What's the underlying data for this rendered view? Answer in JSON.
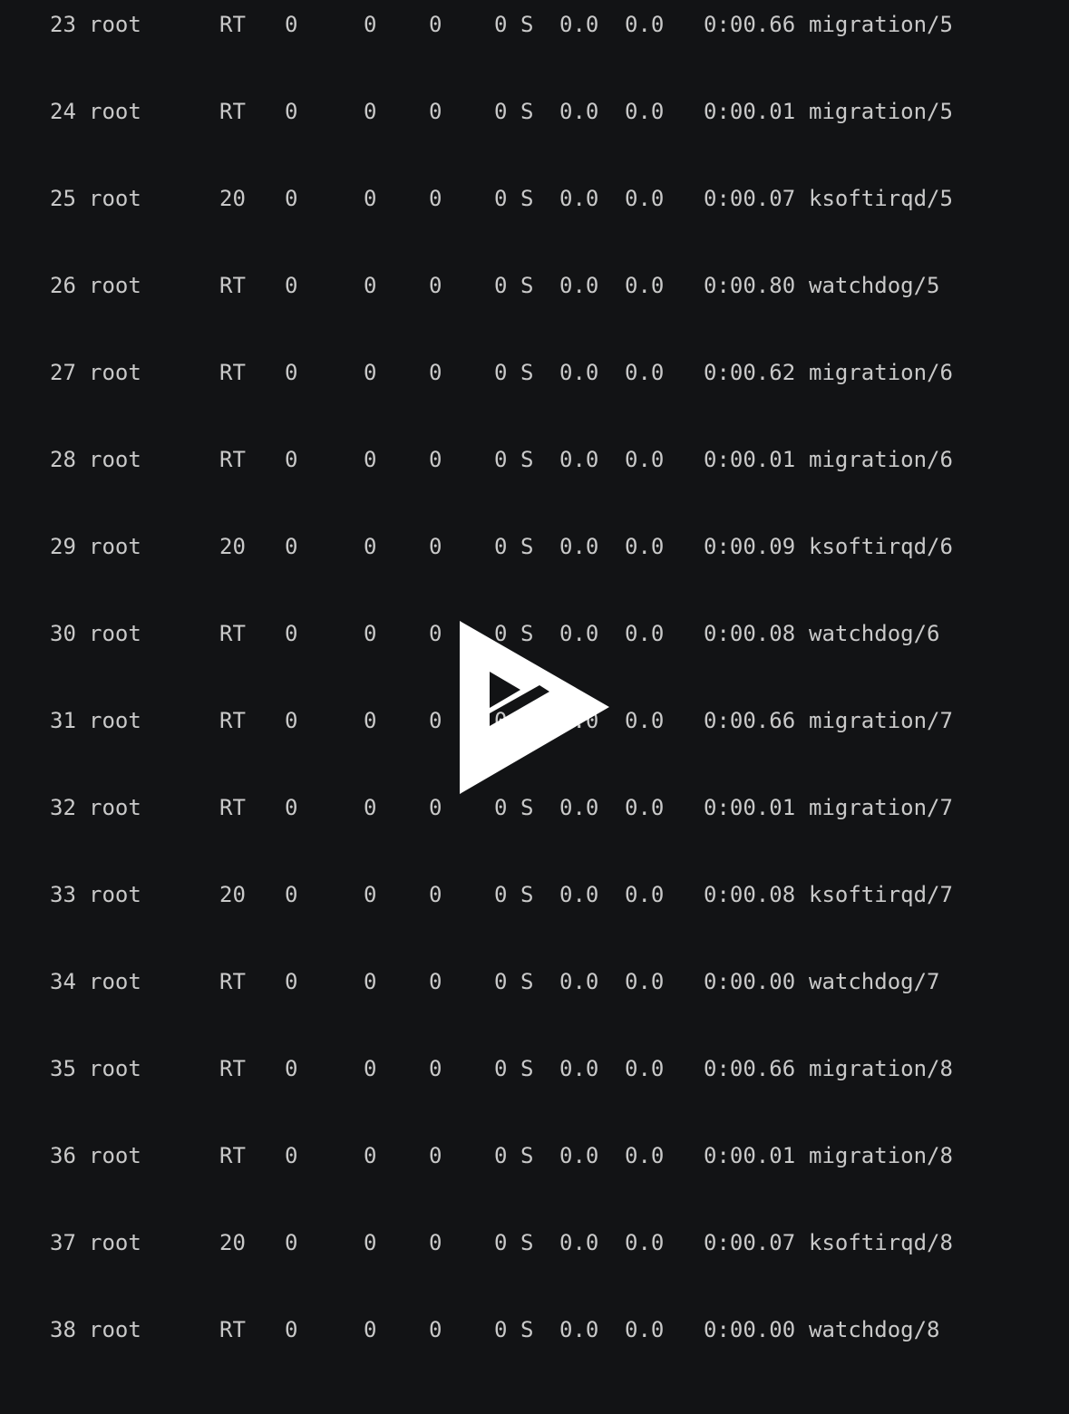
{
  "colors": {
    "background": "#121315",
    "text": "#c9c9c9",
    "overlay_icon": "#ffffff"
  },
  "overlay": {
    "icon": "play-logo-icon"
  },
  "processes": [
    {
      "pid": "23",
      "user": "root",
      "pr": "RT",
      "ni": "0",
      "virt": "0",
      "res": "0",
      "shr": "0",
      "state": "S",
      "cpu": "0.0",
      "mem": "0.0",
      "time": "0:00.66",
      "command": "migration/5"
    },
    {
      "pid": "24",
      "user": "root",
      "pr": "RT",
      "ni": "0",
      "virt": "0",
      "res": "0",
      "shr": "0",
      "state": "S",
      "cpu": "0.0",
      "mem": "0.0",
      "time": "0:00.01",
      "command": "migration/5"
    },
    {
      "pid": "25",
      "user": "root",
      "pr": "20",
      "ni": "0",
      "virt": "0",
      "res": "0",
      "shr": "0",
      "state": "S",
      "cpu": "0.0",
      "mem": "0.0",
      "time": "0:00.07",
      "command": "ksoftirqd/5"
    },
    {
      "pid": "26",
      "user": "root",
      "pr": "RT",
      "ni": "0",
      "virt": "0",
      "res": "0",
      "shr": "0",
      "state": "S",
      "cpu": "0.0",
      "mem": "0.0",
      "time": "0:00.80",
      "command": "watchdog/5"
    },
    {
      "pid": "27",
      "user": "root",
      "pr": "RT",
      "ni": "0",
      "virt": "0",
      "res": "0",
      "shr": "0",
      "state": "S",
      "cpu": "0.0",
      "mem": "0.0",
      "time": "0:00.62",
      "command": "migration/6"
    },
    {
      "pid": "28",
      "user": "root",
      "pr": "RT",
      "ni": "0",
      "virt": "0",
      "res": "0",
      "shr": "0",
      "state": "S",
      "cpu": "0.0",
      "mem": "0.0",
      "time": "0:00.01",
      "command": "migration/6"
    },
    {
      "pid": "29",
      "user": "root",
      "pr": "20",
      "ni": "0",
      "virt": "0",
      "res": "0",
      "shr": "0",
      "state": "S",
      "cpu": "0.0",
      "mem": "0.0",
      "time": "0:00.09",
      "command": "ksoftirqd/6"
    },
    {
      "pid": "30",
      "user": "root",
      "pr": "RT",
      "ni": "0",
      "virt": "0",
      "res": "0",
      "shr": "0",
      "state": "S",
      "cpu": "0.0",
      "mem": "0.0",
      "time": "0:00.08",
      "command": "watchdog/6"
    },
    {
      "pid": "31",
      "user": "root",
      "pr": "RT",
      "ni": "0",
      "virt": "0",
      "res": "0",
      "shr": "0",
      "state": "S",
      "cpu": "0.0",
      "mem": "0.0",
      "time": "0:00.66",
      "command": "migration/7"
    },
    {
      "pid": "32",
      "user": "root",
      "pr": "RT",
      "ni": "0",
      "virt": "0",
      "res": "0",
      "shr": "0",
      "state": "S",
      "cpu": "0.0",
      "mem": "0.0",
      "time": "0:00.01",
      "command": "migration/7"
    },
    {
      "pid": "33",
      "user": "root",
      "pr": "20",
      "ni": "0",
      "virt": "0",
      "res": "0",
      "shr": "0",
      "state": "S",
      "cpu": "0.0",
      "mem": "0.0",
      "time": "0:00.08",
      "command": "ksoftirqd/7"
    },
    {
      "pid": "34",
      "user": "root",
      "pr": "RT",
      "ni": "0",
      "virt": "0",
      "res": "0",
      "shr": "0",
      "state": "S",
      "cpu": "0.0",
      "mem": "0.0",
      "time": "0:00.00",
      "command": "watchdog/7"
    },
    {
      "pid": "35",
      "user": "root",
      "pr": "RT",
      "ni": "0",
      "virt": "0",
      "res": "0",
      "shr": "0",
      "state": "S",
      "cpu": "0.0",
      "mem": "0.0",
      "time": "0:00.66",
      "command": "migration/8"
    },
    {
      "pid": "36",
      "user": "root",
      "pr": "RT",
      "ni": "0",
      "virt": "0",
      "res": "0",
      "shr": "0",
      "state": "S",
      "cpu": "0.0",
      "mem": "0.0",
      "time": "0:00.01",
      "command": "migration/8"
    },
    {
      "pid": "37",
      "user": "root",
      "pr": "20",
      "ni": "0",
      "virt": "0",
      "res": "0",
      "shr": "0",
      "state": "S",
      "cpu": "0.0",
      "mem": "0.0",
      "time": "0:00.07",
      "command": "ksoftirqd/8"
    },
    {
      "pid": "38",
      "user": "root",
      "pr": "RT",
      "ni": "0",
      "virt": "0",
      "res": "0",
      "shr": "0",
      "state": "S",
      "cpu": "0.0",
      "mem": "0.0",
      "time": "0:00.00",
      "command": "watchdog/8"
    }
  ]
}
